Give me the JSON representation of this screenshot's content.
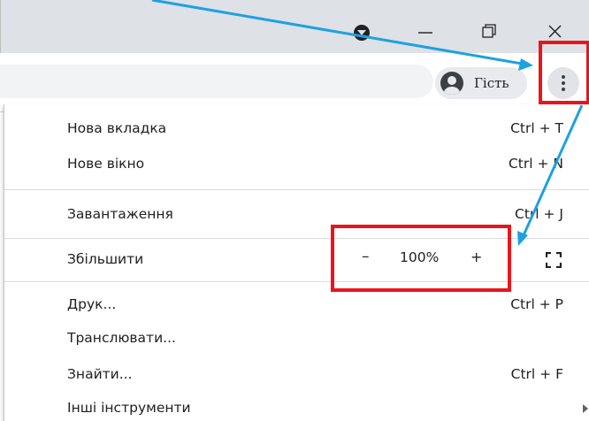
{
  "toolbar": {
    "guest_label": "Гість"
  },
  "menu": {
    "items": [
      {
        "label": "Нова вкладка",
        "shortcut": "Ctrl + T"
      },
      {
        "label": "Нове вікно",
        "shortcut": "Ctrl + N"
      },
      {
        "label": "Завантаження",
        "shortcut": "Ctrl + J"
      },
      {
        "label": "Друк...",
        "shortcut": "Ctrl + P"
      },
      {
        "label": "Транслювати...",
        "shortcut": ""
      },
      {
        "label": "Знайти...",
        "shortcut": "Ctrl + F"
      },
      {
        "label": "Інші інструменти",
        "shortcut": ""
      }
    ],
    "zoom": {
      "label": "Збільшити",
      "minus": "–",
      "value": "100%",
      "plus": "+"
    }
  },
  "colors": {
    "titlebar": "#dee1e6",
    "highlight": "#e8161c",
    "arrow": "#1da1e2"
  }
}
